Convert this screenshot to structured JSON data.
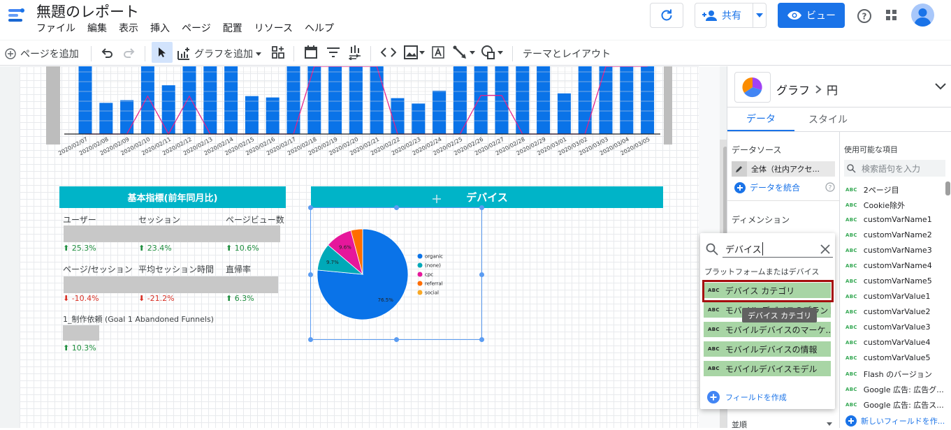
{
  "header": {
    "title": "無題のレポート",
    "menu": [
      "ファイル",
      "編集",
      "表示",
      "挿入",
      "ページ",
      "配置",
      "リソース",
      "ヘルプ"
    ],
    "share_label": "共有",
    "view_label": "ビュー"
  },
  "toolbar": {
    "add_page": "ページを追加",
    "add_chart": "グラフを追加",
    "theme_layout": "テーマとレイアウト"
  },
  "colors": {
    "accent": "#1a73e8",
    "bar": "#0a73e8",
    "line": "#e0218a",
    "header_teal": "#00b4c8",
    "popup_green": "#a8d5a5",
    "highlight_border": "#a50e0e"
  },
  "bar_chart": {
    "dates": [
      "2020/02/07",
      "2020/02/08",
      "2020/02/09",
      "2020/02/10",
      "2020/02/11",
      "2020/02/12",
      "2020/02/13",
      "2020/02/14",
      "2020/02/15",
      "2020/02/16",
      "2020/02/17",
      "2020/02/18",
      "2020/02/19",
      "2020/02/20",
      "2020/02/21",
      "2020/02/22",
      "2020/02/23",
      "2020/02/24",
      "2020/02/25",
      "2020/02/26",
      "2020/02/27",
      "2020/02/28",
      "2020/02/29",
      "2020/03/01",
      "2020/03/02",
      "2020/03/03",
      "2020/03/04",
      "2020/03/05"
    ],
    "values": [
      100,
      46,
      50,
      100,
      72,
      100,
      100,
      100,
      56,
      54,
      100,
      100,
      100,
      100,
      100,
      53,
      45,
      64,
      100,
      100,
      100,
      100,
      100,
      60,
      100,
      100,
      100,
      100
    ],
    "line": [
      0,
      0,
      0,
      56,
      0,
      56,
      0,
      0,
      0,
      0,
      0,
      100,
      100,
      100,
      100,
      0,
      0,
      0,
      0,
      57,
      57,
      0,
      0,
      0,
      0,
      100,
      100,
      100
    ]
  },
  "kpi": {
    "header": "基本指標(前年同月比)",
    "items": [
      {
        "label": "ユーザー",
        "delta": "25.3%",
        "dir": "up"
      },
      {
        "label": "セッション",
        "delta": "23.4%",
        "dir": "up"
      },
      {
        "label": "ページビュー数",
        "delta": "10.6%",
        "dir": "up"
      },
      {
        "label": "ページ/セッション",
        "delta": "-10.4%",
        "dir": "down"
      },
      {
        "label": "平均セッション時間",
        "delta": "-21.2%",
        "dir": "down"
      },
      {
        "label": "直帰率",
        "delta": "6.3%",
        "dir": "up"
      }
    ],
    "goal_label": "1_制作依頼 (Goal 1 Abandoned Funnels)",
    "goal_delta": "10.3%"
  },
  "device_chart": {
    "header": "デバイス"
  },
  "chart_data": {
    "type": "pie",
    "labels": [
      "organic",
      "(none)",
      "cpc",
      "referral",
      "social"
    ],
    "values": [
      76.5,
      9.7,
      9.6,
      4.2,
      0
    ],
    "colors": [
      "#0a73e8",
      "#00a9b8",
      "#e6179b",
      "#ff6d00",
      "#f9a825"
    ],
    "slice_labels": [
      "76.5%",
      "9.7%",
      "9.6%",
      "",
      ""
    ]
  },
  "panel": {
    "chart_label": "グラフ",
    "chart_type": "円",
    "tab_data": "データ",
    "tab_style": "スタイル",
    "datasource_label": "データソース",
    "datasource_value": "全体（社内アクセ...",
    "blend_label": "データを統合",
    "dimension_label": "ディメンション",
    "sort_label": "並順",
    "available_label": "使用可能な項目",
    "search_placeholder": "検索語句を入力",
    "fields": [
      "2ページ目",
      "Cookie除外",
      "customVarName1",
      "customVarName2",
      "customVarName3",
      "customVarName4",
      "customVarName5",
      "customVarValue1",
      "customVarValue2",
      "customVarValue3",
      "customVarValue4",
      "customVarValue5",
      "Flash のバージョン",
      "Google 広告: 広告グ...",
      "Google 広告: 広告ス..."
    ],
    "new_field": "新しいフィールドを作..."
  },
  "popup": {
    "search_value": "デバイス",
    "section": "プラットフォームまたはデバイス",
    "items": [
      "デバイス カテゴリ",
      "モバイル デバイスのブランド",
      "モバイルデバイスのマーケ...",
      "モバイルデバイスの情報",
      "モバイルデバイスモデル"
    ],
    "tooltip": "デバイス カテゴリ",
    "create_field": "フィールドを作成",
    "abc": "ABC"
  }
}
